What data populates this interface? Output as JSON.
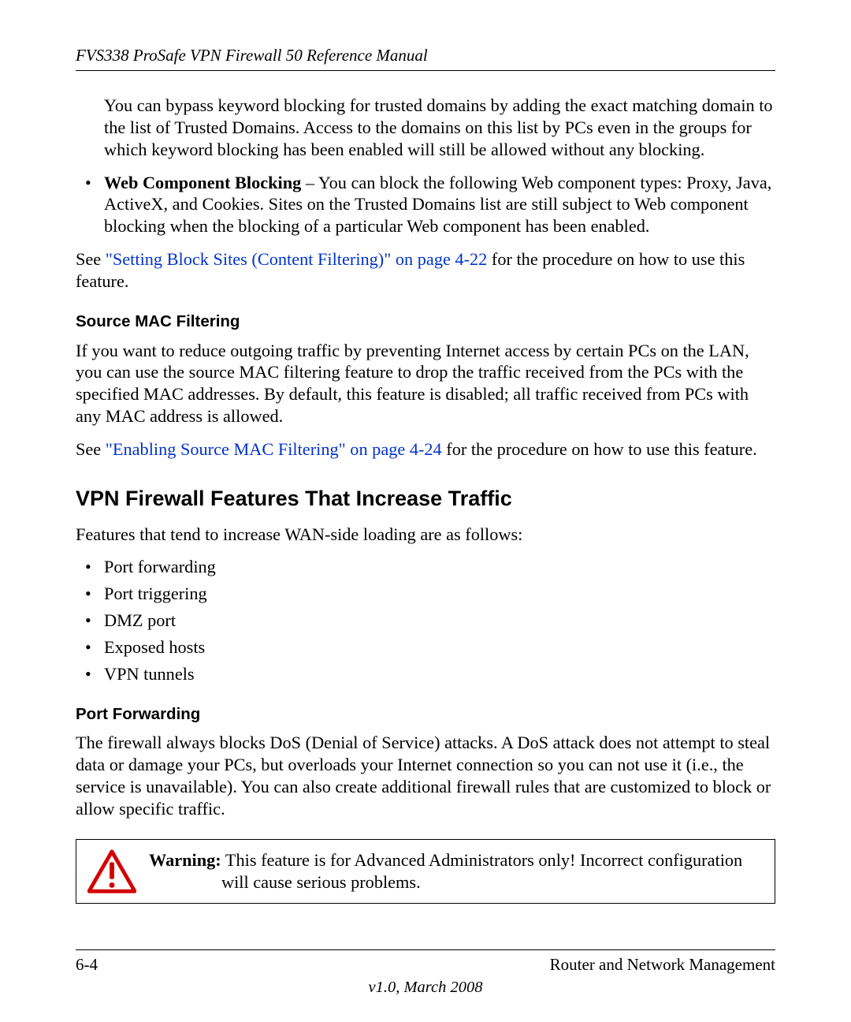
{
  "header": {
    "title": "FVS338 ProSafe VPN Firewall 50 Reference Manual"
  },
  "para_intro": "You can bypass keyword blocking for trusted domains by adding the exact matching domain to the list of Trusted Domains. Access to the domains on this list by PCs even in the groups for which keyword blocking has been enabled will still be allowed without any blocking.",
  "bullet_web": {
    "title": "Web Component Blocking",
    "rest": " – You can block the following Web component types: Proxy, Java, ActiveX, and Cookies. Sites on the Trusted Domains list are still subject to Web component blocking when the blocking of a particular Web component has been enabled."
  },
  "see1": {
    "pre": "See ",
    "link": "\"Setting Block Sites (Content Filtering)\" on page 4-22",
    "post": " for the procedure on how to use this feature."
  },
  "h3_a": "Source MAC Filtering",
  "para_mac": "If you want to reduce outgoing traffic by preventing Internet access by certain PCs on the LAN, you can use the source MAC filtering feature to drop the traffic received from the PCs with the specified MAC addresses. By default, this feature is disabled; all traffic received from PCs with any MAC address is allowed.",
  "see2": {
    "pre": "See ",
    "link": "\"Enabling Source MAC Filtering\" on page 4-24",
    "post": " for the procedure on how to use this feature."
  },
  "h2": "VPN Firewall Features That Increase Traffic",
  "para_features": "Features that tend to increase WAN-side loading are as follows:",
  "feature_list": {
    "i0": "Port forwarding",
    "i1": "Port triggering",
    "i2": "DMZ port",
    "i3": "Exposed hosts",
    "i4": "VPN tunnels"
  },
  "h3_b": "Port Forwarding",
  "para_pf": "The firewall always blocks DoS (Denial of Service) attacks. A DoS attack does not attempt to steal data or damage your PCs, but overloads your Internet connection so you can not use it (i.e., the service is unavailable). You can also create additional firewall rules that are customized to block or allow specific traffic.",
  "warning": {
    "label": "Warning:",
    "text": " This feature is for Advanced Administrators only! Incorrect configuration will cause serious problems."
  },
  "footer": {
    "page": "6-4",
    "section": "Router and Network Management",
    "version": "v1.0, March 2008"
  }
}
